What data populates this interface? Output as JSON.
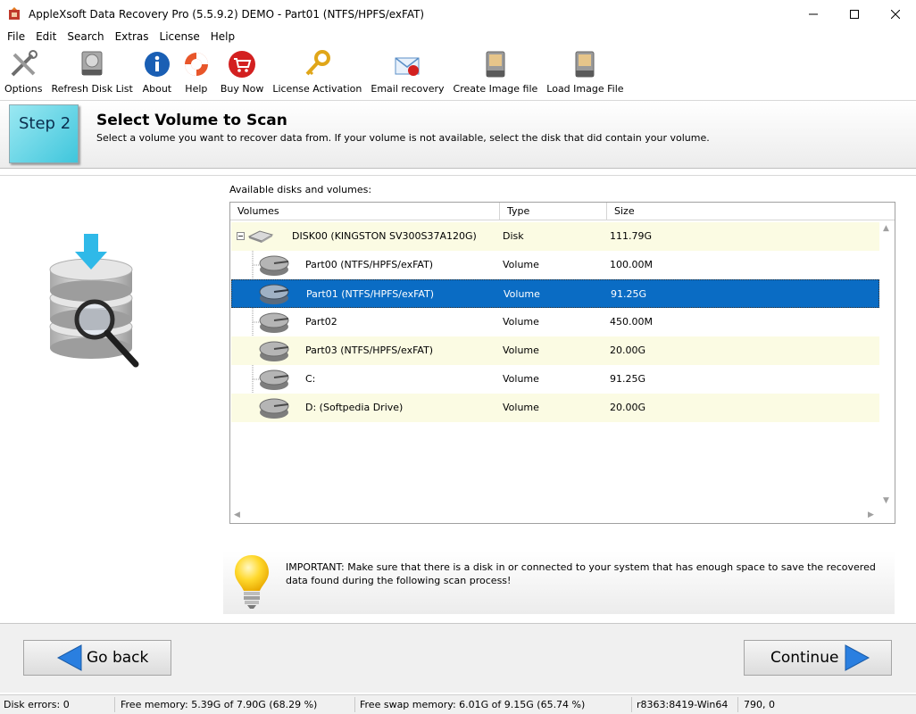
{
  "window": {
    "title": "AppleXsoft Data Recovery Pro (5.5.9.2) DEMO - Part01 (NTFS/HPFS/exFAT)"
  },
  "menu": [
    "File",
    "Edit",
    "Search",
    "Extras",
    "License",
    "Help"
  ],
  "toolbar": [
    {
      "label": "Options",
      "icon": "tools-icon"
    },
    {
      "label": "Refresh Disk List",
      "icon": "disk-drive-icon"
    },
    {
      "label": "About",
      "icon": "info-icon"
    },
    {
      "label": "Help",
      "icon": "lifebuoy-icon"
    },
    {
      "label": "Buy Now",
      "icon": "shopping-cart-icon"
    },
    {
      "label": "License Activation",
      "icon": "key-icon"
    },
    {
      "label": "Email recovery",
      "icon": "email-icon"
    },
    {
      "label": "Create Image file",
      "icon": "create-image-icon"
    },
    {
      "label": "Load Image File",
      "icon": "load-image-icon"
    }
  ],
  "step": {
    "badge": "Step 2",
    "title": "Select Volume to Scan",
    "description": "Select a volume you want to recover data from. If your volume is not available, select the disk that did contain your volume."
  },
  "list": {
    "label": "Available disks and volumes:",
    "columns": [
      "Volumes",
      "Type",
      "Size"
    ],
    "rows": [
      {
        "name": "DISK00 (KINGSTON SV300S37A120G)",
        "type": "Disk",
        "size": "111.79G"
      },
      {
        "name": "Part00 (NTFS/HPFS/exFAT)",
        "type": "Volume",
        "size": "100.00M"
      },
      {
        "name": "Part01 (NTFS/HPFS/exFAT)",
        "type": "Volume",
        "size": "91.25G"
      },
      {
        "name": "Part02",
        "type": "Volume",
        "size": "450.00M"
      },
      {
        "name": "Part03 (NTFS/HPFS/exFAT)",
        "type": "Volume",
        "size": "20.00G"
      },
      {
        "name": "C:",
        "type": "Volume",
        "size": "91.25G"
      },
      {
        "name": "D: (Softpedia Drive)",
        "type": "Volume",
        "size": "20.00G"
      }
    ],
    "selected_index": 2
  },
  "notice": {
    "text": "IMPORTANT: Make sure that there is a disk in or connected to your system that has enough space to save the recovered data found during the following scan process!"
  },
  "nav": {
    "back_label": "Go back",
    "continue_label": "Continue"
  },
  "status": {
    "disk_errors": "Disk errors: 0",
    "free_memory": "Free memory: 5.39G of 7.90G (68.29 %)",
    "free_swap": "Free swap memory: 6.01G of 9.15G (65.74 %)",
    "build": "r8363:8419-Win64",
    "coords": "790, 0"
  },
  "colors": {
    "selection": "#0a6cc4",
    "alt_row": "#fbfbe3",
    "step_badge": "#3fc6dc",
    "arrow_blue": "#2a7fe0"
  }
}
